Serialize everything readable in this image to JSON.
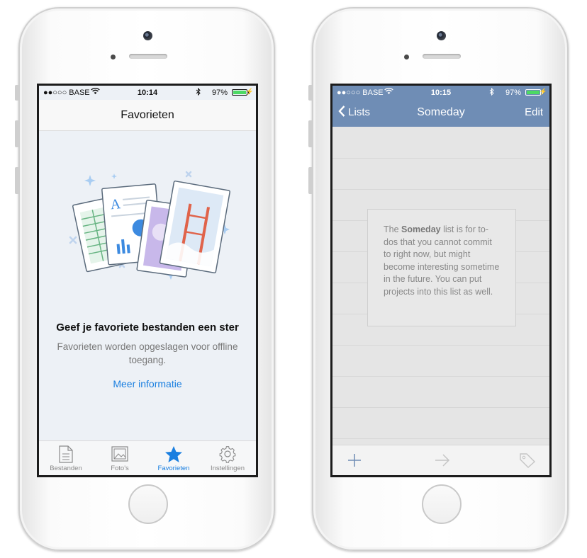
{
  "left_phone": {
    "status": {
      "carrier": "●●○○○ BASE",
      "time": "10:14",
      "battery": "97%"
    },
    "nav_title": "Favorieten",
    "empty_state": {
      "title": "Geef je favoriete bestanden een ster",
      "subtitle": "Favorieten worden opgeslagen voor offline toegang.",
      "link": "Meer informatie"
    },
    "tabs": [
      {
        "label": "Bestanden",
        "icon": "document-icon",
        "active": false
      },
      {
        "label": "Foto's",
        "icon": "photo-icon",
        "active": false
      },
      {
        "label": "Favorieten",
        "icon": "star-icon",
        "active": true
      },
      {
        "label": "Instellingen",
        "icon": "gear-icon",
        "active": false
      }
    ]
  },
  "right_phone": {
    "status": {
      "carrier": "●●○○○ BASE",
      "time": "10:15",
      "battery": "97%"
    },
    "back_label": "Lists",
    "nav_title": "Someday",
    "edit_label": "Edit",
    "note": {
      "prefix": "The ",
      "bold": "Someday",
      "body": " list is for to-dos that you cannot commit to right now, but might become interesting sometime in the future. You can put projects into this list as well."
    },
    "toolbar": [
      "plus-icon",
      "arrow-right-icon",
      "tag-icon"
    ]
  },
  "colors": {
    "accent_blue": "#1a7fe0",
    "nav_slate": "#6f8db5",
    "battery_green": "#4cd964"
  }
}
